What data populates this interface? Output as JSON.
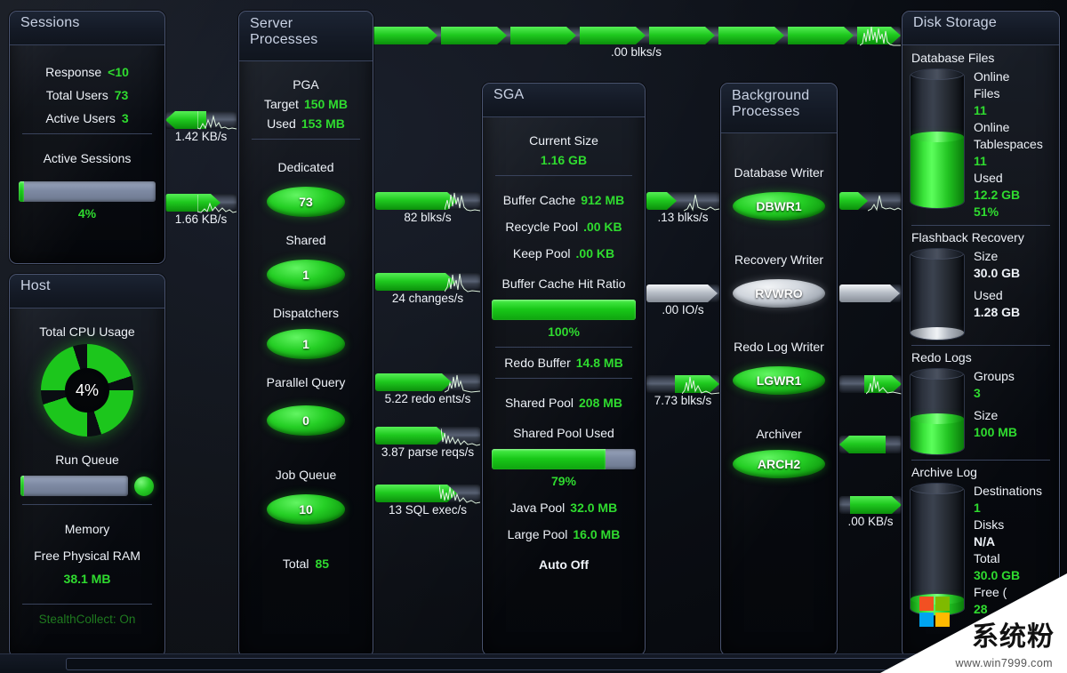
{
  "sessions": {
    "title": "Sessions",
    "metrics": [
      {
        "label": "Response",
        "value": "<10"
      },
      {
        "label": "Total Users",
        "value": "73"
      },
      {
        "label": "Active Users",
        "value": "3"
      }
    ],
    "active_sessions_label": "Active Sessions",
    "active_sessions_pct": "4%",
    "active_sessions_fill": 4
  },
  "host": {
    "title": "Host",
    "cpu_label": "Total CPU Usage",
    "cpu_value": "4%",
    "run_queue_label": "Run Queue",
    "run_queue_fill": 3,
    "memory_label": "Memory",
    "free_ram_label": "Free Physical RAM",
    "free_ram_value": "38.1 MB",
    "stealth_collect": "StealthCollect: On"
  },
  "server_processes": {
    "title_line1": "Server",
    "title_line2": "Processes",
    "pga_label": "PGA",
    "pga": [
      {
        "label": "Target",
        "value": "150 MB"
      },
      {
        "label": "Used",
        "value": "153 MB"
      }
    ],
    "pools": [
      {
        "label": "Dedicated",
        "value": "73"
      },
      {
        "label": "Shared",
        "value": "1"
      },
      {
        "label": "Dispatchers",
        "value": "1"
      },
      {
        "label": "Parallel Query",
        "value": "0"
      },
      {
        "label": "Job Queue",
        "value": "10"
      }
    ],
    "total_label": "Total",
    "total_value": "85"
  },
  "sga": {
    "title": "SGA",
    "current_size_label": "Current Size",
    "current_size_value": "1.16 GB",
    "metrics_top": [
      {
        "label": "Buffer Cache",
        "value": "912 MB"
      },
      {
        "label": "Recycle Pool",
        "value": ".00 KB"
      },
      {
        "label": "Keep Pool",
        "value": ".00 KB"
      }
    ],
    "hit_ratio_label": "Buffer Cache Hit Ratio",
    "hit_ratio_pct": "100%",
    "hit_ratio_fill": 100,
    "redo_buffer": {
      "label": "Redo Buffer",
      "value": "14.8 MB"
    },
    "shared_pool": {
      "label": "Shared Pool",
      "value": "208 MB"
    },
    "shared_pool_used_label": "Shared Pool Used",
    "shared_pool_used_pct": "79%",
    "shared_pool_used_fill": 79,
    "metrics_bottom": [
      {
        "label": "Java Pool",
        "value": "32.0 MB"
      },
      {
        "label": "Large Pool",
        "value": "16.0 MB"
      }
    ],
    "auto_label": "Auto Off"
  },
  "background_processes": {
    "title_line1": "Background",
    "title_line2": "Processes",
    "items": [
      {
        "label": "Database Writer",
        "value": "DBWR1",
        "state": "green"
      },
      {
        "label": "Recovery Writer",
        "value": "RVWRO",
        "state": "grey"
      },
      {
        "label": "Redo Log Writer",
        "value": "LGWR1",
        "state": "green"
      },
      {
        "label": "Archiver",
        "value": "ARCH2",
        "state": "green"
      }
    ]
  },
  "disk_storage": {
    "title": "Disk Storage",
    "sections": [
      {
        "heading": "Database Files",
        "fill": 51,
        "fill_color": "green",
        "rows": [
          {
            "label": "Online",
            "value": ""
          },
          {
            "label": "Files",
            "value": "11"
          },
          {
            "label": "Online",
            "value": ""
          },
          {
            "label": "Tablespaces",
            "value": "11"
          },
          {
            "label": "Used",
            "value": "12.2 GB"
          },
          {
            "label": "",
            "value": "51%"
          }
        ]
      },
      {
        "heading": "Flashback Recovery",
        "fill": 8,
        "fill_color": "grey",
        "rows": [
          {
            "label": "Size",
            "value_white": "30.0 GB"
          },
          {
            "label": "Used",
            "value_white": "1.28 GB"
          }
        ]
      },
      {
        "heading": "Redo Logs",
        "fill": 42,
        "fill_color": "green",
        "rows": [
          {
            "label": "Groups",
            "value": "3"
          },
          {
            "label": "Size",
            "value": "100 MB"
          }
        ]
      },
      {
        "heading": "Archive Log",
        "fill": 12,
        "fill_color": "green",
        "rows": [
          {
            "label": "Destinations",
            "value": "1"
          },
          {
            "label": "Disks",
            "value_white": "N/A"
          },
          {
            "label": "Total",
            "value": "30.0 GB"
          },
          {
            "label": "Free (",
            "value": "28"
          }
        ]
      }
    ]
  },
  "flows": {
    "top": {
      "label": ".00 blks/s",
      "state": "green"
    },
    "left_upper": {
      "label": "1.42 KB/s",
      "state": "green"
    },
    "left_lower": {
      "label": "1.66 KB/s",
      "state": "green"
    },
    "mid_1": {
      "label": "82 blks/s",
      "state": "green"
    },
    "mid_2": {
      "label": "24 changes/s",
      "state": "green"
    },
    "mid_3": {
      "label": "5.22 redo ents/s",
      "state": "green"
    },
    "mid_4": {
      "label": "3.87 parse reqs/s",
      "state": "green"
    },
    "mid_5": {
      "label": "13 SQL exec/s",
      "state": "green"
    },
    "sga_bg_1": {
      "label": ".13 blks/s",
      "state": "green"
    },
    "sga_bg_2": {
      "label": ".00 IO/s",
      "state": "grey"
    },
    "sga_bg_3": {
      "label": "7.73 blks/s",
      "state": "green"
    },
    "bg_disk_1": {
      "label": "",
      "state": "green"
    },
    "bg_disk_2": {
      "label": "",
      "state": "grey"
    },
    "bg_disk_3": {
      "label": "",
      "state": "green"
    },
    "bg_disk_4": {
      "label": "",
      "state": "green"
    },
    "bg_disk_5": {
      "label": ".00 KB/s",
      "state": "green"
    }
  },
  "watermark": {
    "brand_1": "系",
    "brand_2": "统",
    "brand_3": "粉",
    "url": "www.win7999.com"
  },
  "colors": {
    "accent_green": "#2fdb2f",
    "text_white": "#eef2f8",
    "panel_border": "#4a5470",
    "title_text": "#c9d2e4"
  }
}
